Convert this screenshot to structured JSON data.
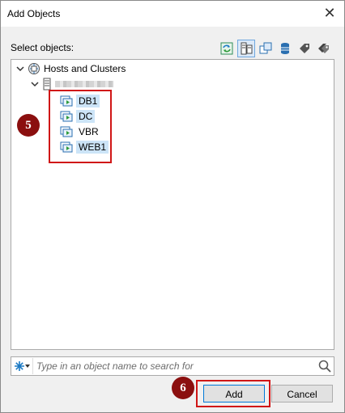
{
  "window": {
    "title": "Add Objects",
    "close_glyph": "✕"
  },
  "select_objects_label": "Select objects:",
  "toolbar": {
    "buttons": [
      {
        "icon": "refresh-icon",
        "active": false
      },
      {
        "icon": "hosts-and-clusters-view-icon",
        "active": true
      },
      {
        "icon": "vms-and-templates-view-icon",
        "active": false
      },
      {
        "icon": "datastores-view-icon",
        "active": false
      },
      {
        "icon": "tag-icon",
        "active": false
      },
      {
        "icon": "tags-icon",
        "active": false
      }
    ]
  },
  "tree": {
    "root_label": "Hosts and Clusters",
    "vms": [
      {
        "label": "DB1",
        "selected": true
      },
      {
        "label": "DC",
        "selected": true
      },
      {
        "label": "VBR",
        "selected": false
      },
      {
        "label": "WEB1",
        "selected": true
      }
    ]
  },
  "annotations": {
    "step5": "5",
    "step6": "6",
    "highlight_color": "#d01616",
    "step_color": "#8b0f0f"
  },
  "search": {
    "placeholder": "Type in an object name to search for",
    "value": ""
  },
  "buttons": {
    "add": "Add",
    "cancel": "Cancel"
  },
  "colors": {
    "selection": "#cce4f7",
    "accent": "#0078d7"
  }
}
